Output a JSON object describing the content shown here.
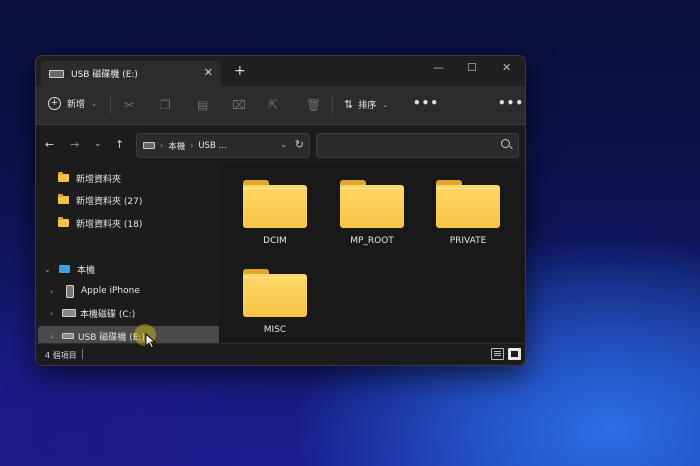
{
  "window": {
    "tab_title": "USB 磁碟機 (E:)",
    "tab_close": "✕",
    "new_tab": "+",
    "minimize": "—",
    "maximize": "☐",
    "close": "✕"
  },
  "toolbar": {
    "new_label": "新增",
    "sort_label": "排序",
    "more": "•••"
  },
  "address": {
    "crumbs": [
      "本機",
      "USB ..."
    ]
  },
  "search": {
    "placeholder": ""
  },
  "nav": {
    "items": [
      {
        "label": "新增資料夾"
      },
      {
        "label": "新增資料夾 (27)"
      },
      {
        "label": "新增資料夾 (18)"
      },
      {
        "label": "本機"
      },
      {
        "label": "Apple iPhone"
      },
      {
        "label": "本機磁碟 (C:)"
      },
      {
        "label": "USB 磁碟機 (E:)"
      }
    ]
  },
  "folders": [
    {
      "name": "DCIM"
    },
    {
      "name": "MP_ROOT"
    },
    {
      "name": "PRIVATE"
    },
    {
      "name": "MISC"
    }
  ],
  "status": {
    "count": "4 個項目"
  },
  "colors": {
    "folder": "#f6c445",
    "accent": "#3aa0e6",
    "selection": "#4a4a4a"
  }
}
